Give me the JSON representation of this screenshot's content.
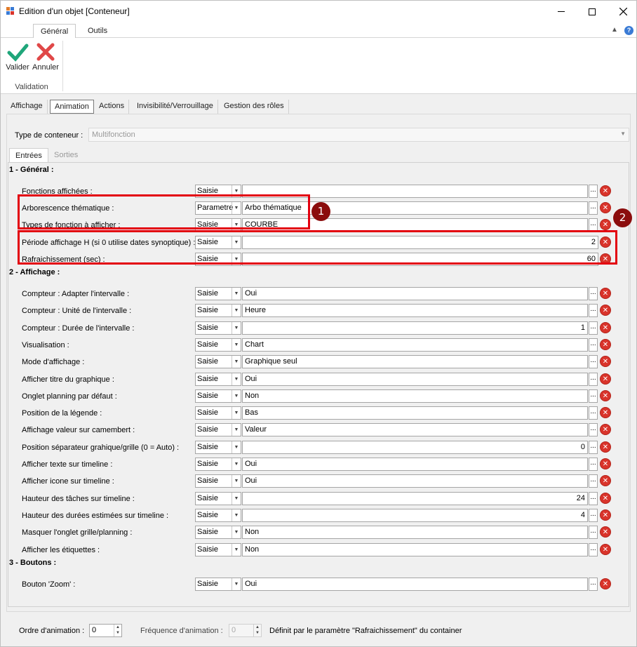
{
  "window": {
    "title": "Edition d'un objet [Conteneur]"
  },
  "ribbon": {
    "tabs": [
      {
        "label": "Général"
      },
      {
        "label": "Outils"
      }
    ],
    "buttons": {
      "validate": "Valider",
      "cancel": "Annuler"
    },
    "group_label": "Validation"
  },
  "main_tabs": [
    {
      "label": "Affichage"
    },
    {
      "label": "Animation"
    },
    {
      "label": "Actions"
    },
    {
      "label": "Invisibilité/Verrouillage"
    },
    {
      "label": "Gestion des rôles"
    }
  ],
  "container_type": {
    "label": "Type de conteneur :",
    "value": "Multifonction"
  },
  "sub_tabs": [
    {
      "label": "Entrées"
    },
    {
      "label": "Sorties"
    }
  ],
  "sections": {
    "general": "1 - Général :",
    "display": "2 - Affichage :",
    "buttons": "3 - Boutons :"
  },
  "rows": [
    {
      "label": "Fonctions affichées :",
      "mode": "Saisie",
      "value": ""
    },
    {
      "label": "Arborescence thématique :",
      "mode": "Parametre",
      "value": "Arbo thématique"
    },
    {
      "label": "Types de fonction à afficher :",
      "mode": "Saisie",
      "value": "COURBE"
    },
    {
      "label": "Période affichage H (si 0 utilise dates synoptique) :",
      "mode": "Saisie",
      "value": "2"
    },
    {
      "label": "Rafraichissement (sec) :",
      "mode": "Saisie",
      "value": "60"
    },
    {
      "label": "Compteur : Adapter l'intervalle :",
      "mode": "Saisie",
      "value": "Oui"
    },
    {
      "label": "Compteur : Unité de l'intervalle :",
      "mode": "Saisie",
      "value": "Heure"
    },
    {
      "label": "Compteur : Durée de l'intervalle :",
      "mode": "Saisie",
      "value": "1"
    },
    {
      "label": "Visualisation :",
      "mode": "Saisie",
      "value": "Chart"
    },
    {
      "label": "Mode d'affichage :",
      "mode": "Saisie",
      "value": "Graphique seul"
    },
    {
      "label": "Afficher titre du graphique :",
      "mode": "Saisie",
      "value": "Oui"
    },
    {
      "label": "Onglet planning par défaut :",
      "mode": "Saisie",
      "value": "Non"
    },
    {
      "label": "Position de la légende :",
      "mode": "Saisie",
      "value": "Bas"
    },
    {
      "label": "Affichage valeur sur camembert :",
      "mode": "Saisie",
      "value": "Valeur"
    },
    {
      "label": "Position séparateur grahique/grille (0 = Auto) :",
      "mode": "Saisie",
      "value": "0"
    },
    {
      "label": "Afficher texte sur timeline :",
      "mode": "Saisie",
      "value": "Oui"
    },
    {
      "label": "Afficher icone sur timeline :",
      "mode": "Saisie",
      "value": "Oui"
    },
    {
      "label": "Hauteur des tâches sur timeline :",
      "mode": "Saisie",
      "value": "24"
    },
    {
      "label": "Hauteur des durées estimées sur timeline :",
      "mode": "Saisie",
      "value": "4"
    },
    {
      "label": "Masquer l'onglet grille/planning :",
      "mode": "Saisie",
      "value": "Non"
    },
    {
      "label": "Afficher les étiquettes :",
      "mode": "Saisie",
      "value": "Non"
    },
    {
      "label": "Bouton 'Zoom' :",
      "mode": "Saisie",
      "value": "Oui"
    }
  ],
  "badges": {
    "one": "1",
    "two": "2"
  },
  "footer": {
    "order_label": "Ordre d'animation :",
    "order_value": "0",
    "freq_label": "Fréquence d'animation :",
    "freq_value": "0",
    "freq_note": "Définit par le paramètre \"Rafraichissement\" du container"
  },
  "colors": {
    "highlight": "#e3000f",
    "badge": "#8b0d0d",
    "validate_icon": "#1fa67a",
    "cancel_icon": "#e04848",
    "delete_icon": "#d9342b"
  }
}
